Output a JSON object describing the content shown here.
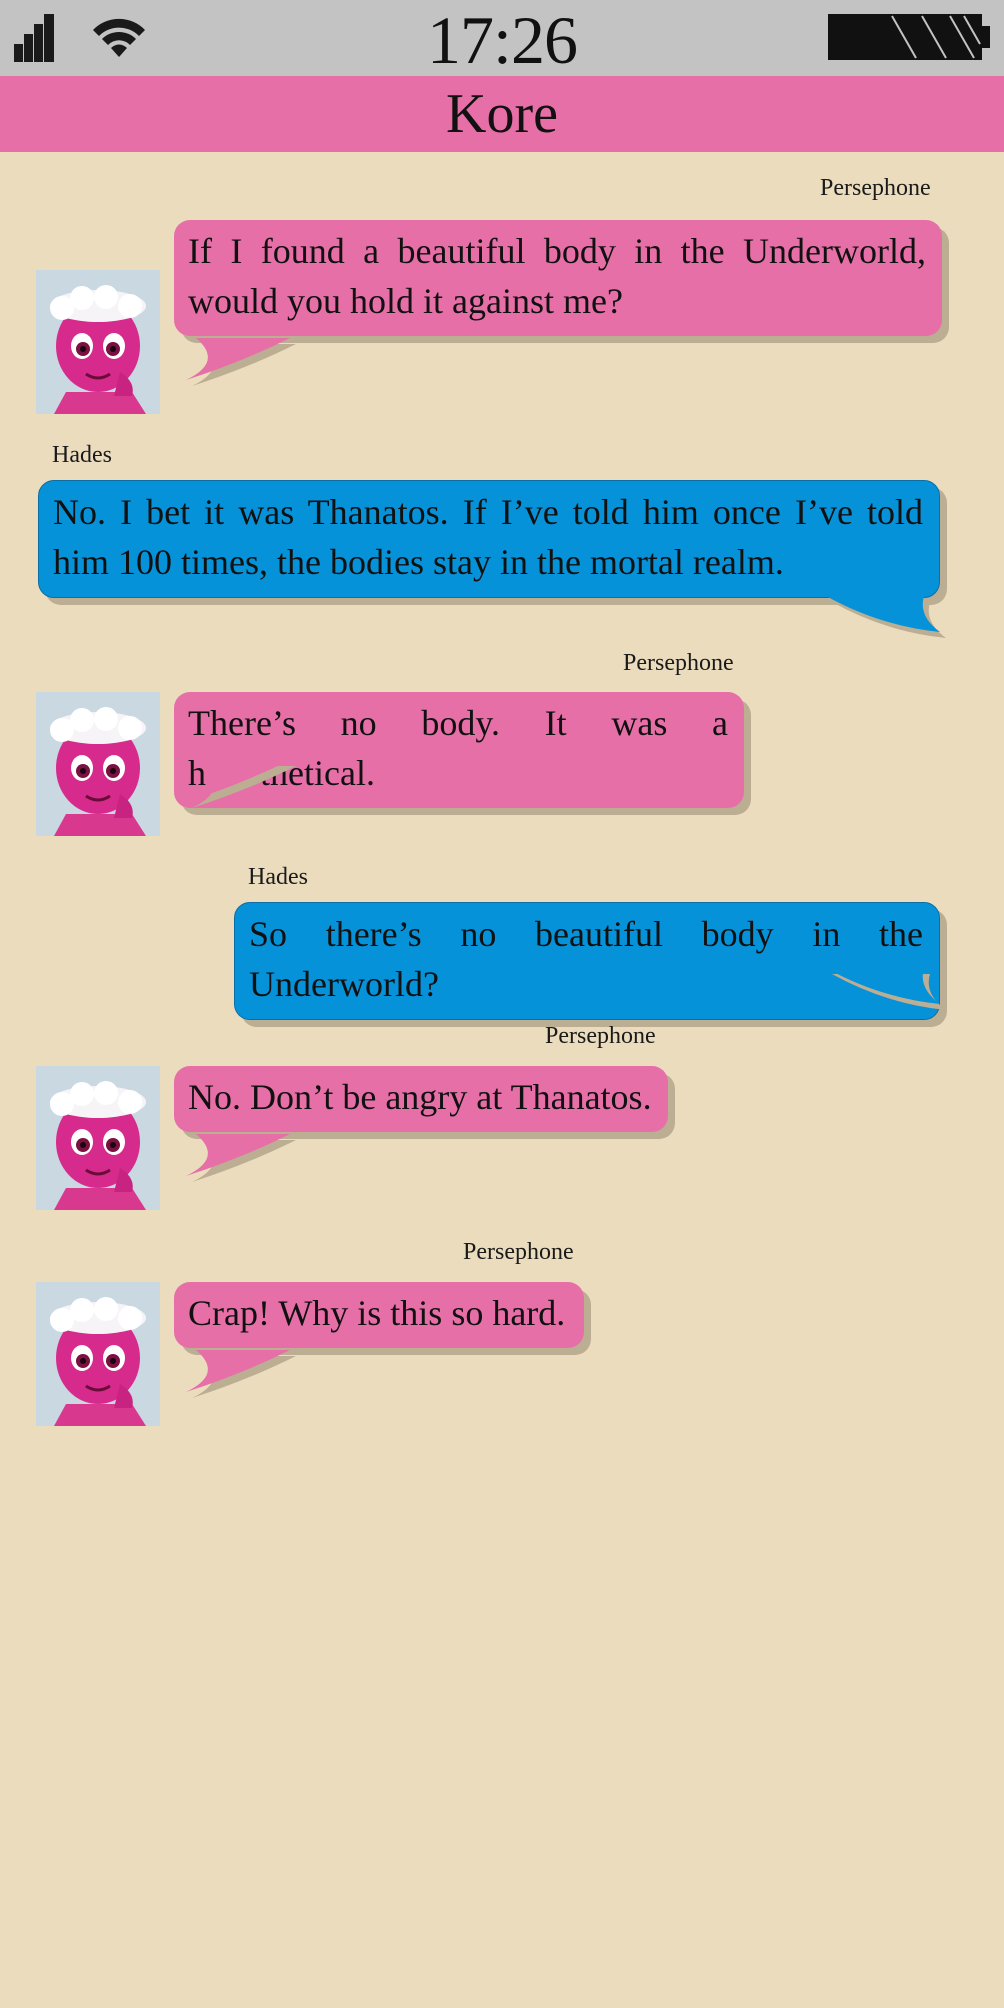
{
  "status_bar": {
    "time": "17:26",
    "signal_icon": "signal-bars-icon",
    "wifi_icon": "wifi-icon",
    "battery_icon": "battery-icon"
  },
  "header": {
    "title": "Kore"
  },
  "colors": {
    "background": "#ebdcbe",
    "status_bar": "#c3c3c3",
    "header": "#e76fa7",
    "persephone_bubble": "#e76fa7",
    "hades_bubble": "#0692d9"
  },
  "messages": [
    {
      "sender": "Persephone",
      "text": "If I found a beautiful body in the Underworld, would you hold it against me?",
      "side": "left",
      "avatar": true
    },
    {
      "sender": "Hades",
      "text": "No. I bet it was Thanatos. If I’ve told him once I’ve told him 100 times, the bodies stay in the mortal realm.",
      "side": "right",
      "avatar": false
    },
    {
      "sender": "Persephone",
      "text": "There’s no body. It was a hypothetical.",
      "side": "left",
      "avatar": true
    },
    {
      "sender": "Hades",
      "text": "So there’s no beautiful body in the Underworld?",
      "side": "right",
      "avatar": false
    },
    {
      "sender": "Persephone",
      "text": "No. Don’t be angry at Thanatos.",
      "side": "left",
      "avatar": true
    },
    {
      "sender": "Persephone",
      "text": "Crap! Why is this so hard.",
      "side": "left",
      "avatar": true
    }
  ]
}
